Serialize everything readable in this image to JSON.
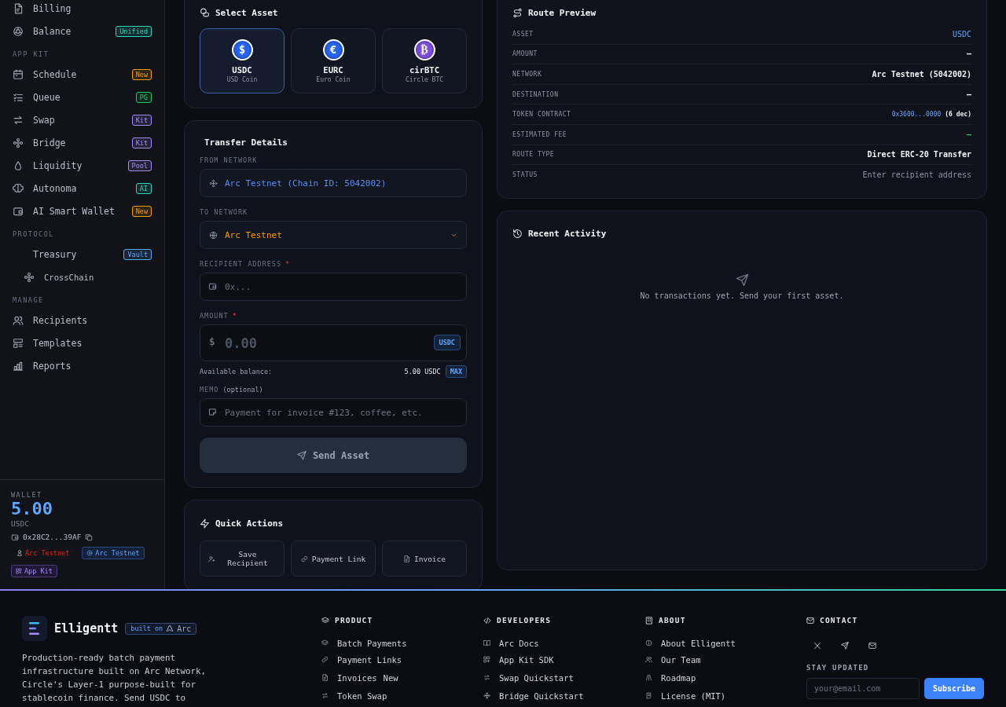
{
  "sidebar": {
    "sections": [
      {
        "items": [
          {
            "label": "Billing"
          },
          {
            "label": "Balance",
            "badge": {
              "text": "Unified",
              "color": "#2dd4bf"
            }
          }
        ]
      },
      {
        "heading": "APP KIT",
        "items": [
          {
            "label": "Schedule",
            "badge": {
              "text": "New",
              "color": "#f59e0b"
            }
          },
          {
            "label": "Queue",
            "badge": {
              "text": "PG",
              "color": "#22c55e"
            }
          },
          {
            "label": "Swap",
            "badge": {
              "text": "Kit",
              "color": "#a78bfa"
            }
          },
          {
            "label": "Bridge",
            "badge": {
              "text": "Kit",
              "color": "#a78bfa"
            }
          },
          {
            "label": "Liquidity",
            "badge": {
              "text": "Pool",
              "color": "#a78bfa"
            }
          },
          {
            "label": "Autonoma",
            "badge": {
              "text": "AI",
              "color": "#2dd4bf"
            }
          },
          {
            "label": "AI Smart Wallet",
            "badge": {
              "text": "New",
              "color": "#f59e0b"
            }
          }
        ]
      },
      {
        "heading": "PROTOCOL",
        "items": [
          {
            "label": "Treasury",
            "badge": {
              "text": "Vault",
              "color": "#60a5fa"
            },
            "children": [
              {
                "label": "CrossChain"
              }
            ]
          }
        ]
      },
      {
        "heading": "MANAGE",
        "items": [
          {
            "label": "Recipients"
          },
          {
            "label": "Templates"
          },
          {
            "label": "Reports"
          }
        ]
      }
    ],
    "wallet": {
      "label": "WALLET",
      "balance": "5.00",
      "unit": "USDC",
      "address": "0x28C2...39AF",
      "chips": [
        {
          "text": "Arc Testnet",
          "kind": "alert"
        },
        {
          "text": "Arc Testnet",
          "kind": "network"
        },
        {
          "text": "App Kit",
          "kind": "kit"
        }
      ]
    }
  },
  "select_asset": {
    "title": "Select Asset",
    "assets": [
      {
        "symbol": "$",
        "code": "USDC",
        "name": "USD Coin",
        "color": "#2563eb",
        "selected": true
      },
      {
        "symbol": "€",
        "code": "EURC",
        "name": "Euro Coin",
        "color": "#2563eb",
        "selected": false
      },
      {
        "symbol": "₿",
        "code": "cirBTC",
        "name": "Circle BTC",
        "color": "#7c4ddb",
        "selected": false
      }
    ]
  },
  "transfer": {
    "title": "Transfer Details",
    "from_network": {
      "label": "FROM NETWORK",
      "value": "Arc Testnet (Chain ID: 5042002)"
    },
    "to_network": {
      "label": "TO NETWORK",
      "value": "Arc Testnet"
    },
    "recipient": {
      "label": "RECIPIENT ADDRESS",
      "required_mark": "*",
      "placeholder": "0x..."
    },
    "amount": {
      "label": "AMOUNT",
      "required_mark": "*",
      "currency_symbol": "$",
      "placeholder": "0.00",
      "unit": "USDC"
    },
    "balance": {
      "label": "Available balance:",
      "value": "5.00 USDC",
      "action": "MAX"
    },
    "memo": {
      "label": "MEMO",
      "hint": "(optional)",
      "placeholder": "Payment for invoice #123, coffee, etc."
    },
    "send_button": {
      "label": "Send Asset",
      "disabled": true
    }
  },
  "quick_actions": {
    "title": "Quick Actions",
    "actions": [
      "Save Recipient",
      "Payment Link",
      "Invoice"
    ]
  },
  "route_preview": {
    "title": "Route Preview",
    "rows": [
      {
        "label": "ASSET",
        "value": "USDC",
        "kind": "accent"
      },
      {
        "label": "AMOUNT",
        "value": "–",
        "kind": "strong"
      },
      {
        "label": "NETWORK",
        "value": "Arc Testnet (5042002)",
        "kind": "strong"
      },
      {
        "label": "DESTINATION",
        "value": "–",
        "kind": "strong"
      },
      {
        "label": "TOKEN CONTRACT",
        "value": "0x3600...0000",
        "suffix": "(6 dec)",
        "kind": "contract"
      },
      {
        "label": "ESTIMATED FEE",
        "value": "–",
        "kind": "positive"
      },
      {
        "label": "ROUTE TYPE",
        "value": "Direct ERC-20 Transfer",
        "kind": "strong"
      },
      {
        "label": "STATUS",
        "value": "Enter recipient address",
        "kind": "muted"
      }
    ]
  },
  "recent_activity": {
    "title": "Recent Activity",
    "empty_text": "No transactions yet. Send your first asset."
  },
  "footer": {
    "brand": {
      "name": "Elligentt",
      "badge_prefix": "built on",
      "badge_name": "Arc",
      "description": "Production-ready batch payment infrastructure built on Arc Network, Circle's Layer-1 purpose-built for stablecoin finance. Send USDC to"
    },
    "columns": [
      {
        "title": "PRODUCT",
        "links": [
          {
            "label": "Batch Payments"
          },
          {
            "label": "Payment Links"
          },
          {
            "label": "Invoices",
            "badge": "New"
          },
          {
            "label": "Token Swap"
          }
        ]
      },
      {
        "title": "DEVELOPERS",
        "links": [
          {
            "label": "Arc Docs"
          },
          {
            "label": "App Kit SDK"
          },
          {
            "label": "Swap Quickstart"
          },
          {
            "label": "Bridge Quickstart"
          }
        ]
      },
      {
        "title": "ABOUT",
        "links": [
          {
            "label": "About Elligentt"
          },
          {
            "label": "Our Team"
          },
          {
            "label": "Roadmap"
          },
          {
            "label": "License (MIT)"
          }
        ]
      }
    ],
    "contact": {
      "title": "CONTACT",
      "subtitle": "STAY UPDATED",
      "email_placeholder": "your@email.com",
      "subscribe": "Subscribe"
    }
  }
}
